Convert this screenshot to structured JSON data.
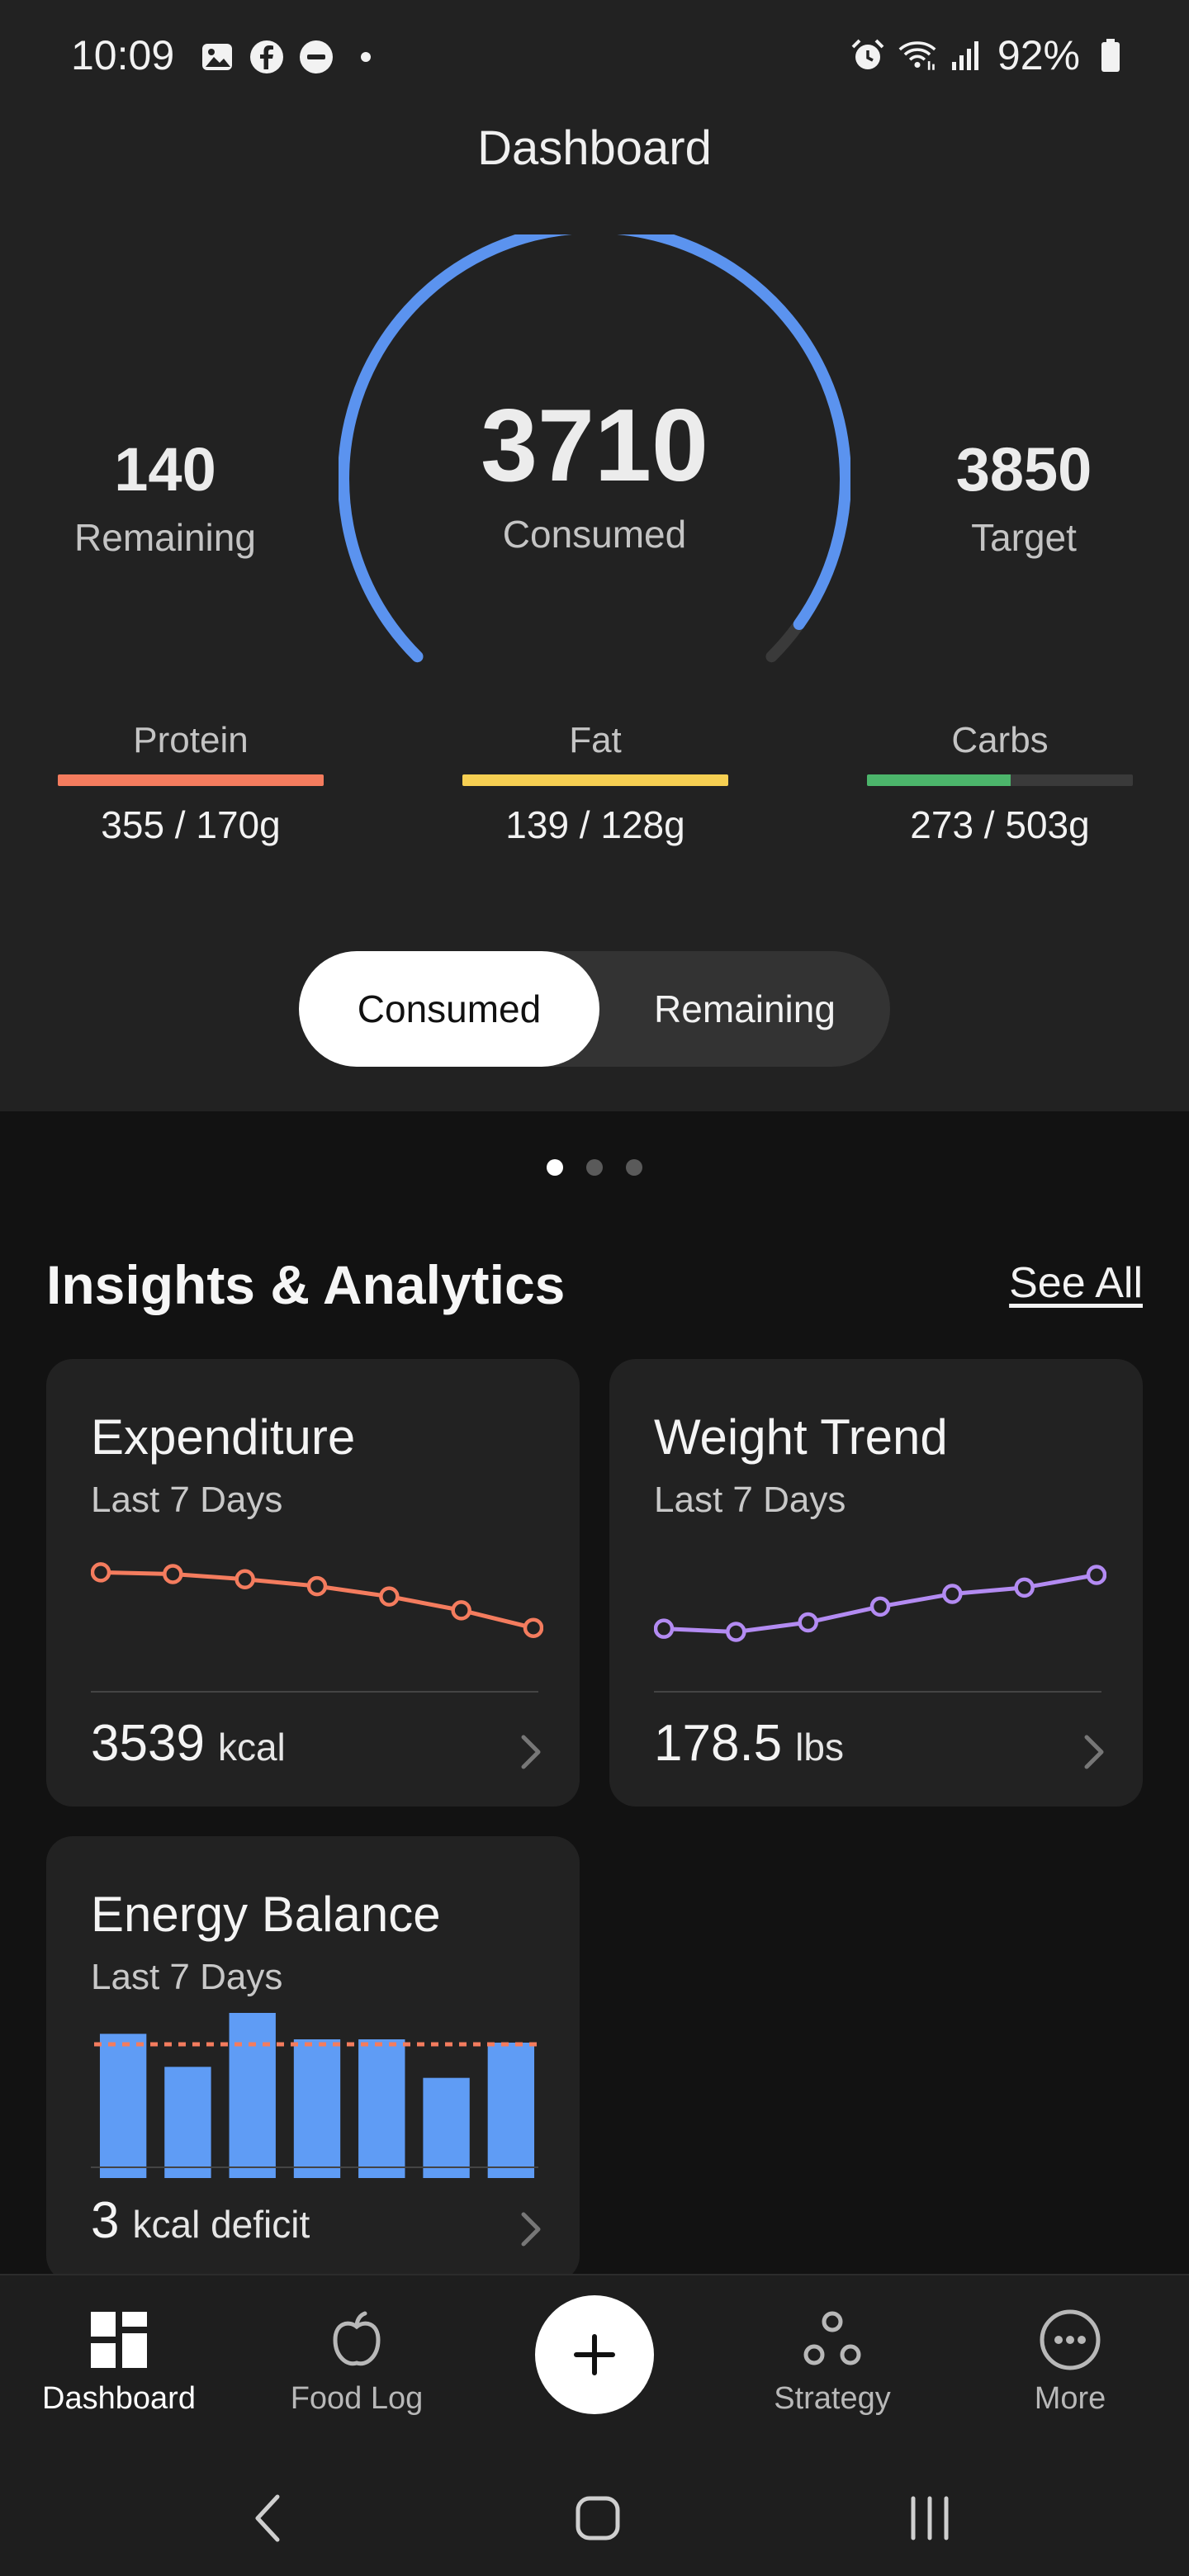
{
  "status_bar": {
    "time": "10:09",
    "battery": "92%",
    "icons": [
      "gallery-icon",
      "facebook-icon",
      "do-not-disturb-icon",
      "dot-icon",
      "alarm-icon",
      "wifi-icon",
      "signal-icon",
      "battery-icon"
    ]
  },
  "header": {
    "title": "Dashboard"
  },
  "summary": {
    "remaining_value": "140",
    "remaining_label": "Remaining",
    "consumed_value": "3710",
    "consumed_label": "Consumed",
    "target_value": "3850",
    "target_label": "Target",
    "gauge_progress": 0.964,
    "gauge_color": "#5b93ef"
  },
  "macros": [
    {
      "label": "Protein",
      "value": "355 / 170g",
      "progress": 1.0,
      "color": "#f47c5e"
    },
    {
      "label": "Fat",
      "value": "139 / 128g",
      "progress": 1.0,
      "color": "#f6cf52"
    },
    {
      "label": "Carbs",
      "value": "273 / 503g",
      "progress": 0.54,
      "color": "#4cb56b"
    }
  ],
  "toggle": {
    "consumed": "Consumed",
    "remaining": "Remaining",
    "selected": "Consumed"
  },
  "pager": {
    "count": 3,
    "active": 0
  },
  "insights": {
    "title": "Insights & Analytics",
    "see_all": "See All",
    "expenditure": {
      "title": "Expenditure",
      "subtitle": "Last 7 Days",
      "value": "3539",
      "unit": "kcal",
      "color": "#f47c5e"
    },
    "weight": {
      "title": "Weight Trend",
      "subtitle": "Last 7 Days",
      "value": "178.5",
      "unit": "lbs",
      "color": "#b38bf2"
    },
    "energy": {
      "title": "Energy Balance",
      "subtitle": "Last 7 Days",
      "value": "3",
      "unit": "kcal deficit",
      "bar_color": "#5f9cf5",
      "line_color": "#f47c5e"
    }
  },
  "chart_data": [
    {
      "type": "line",
      "title": "Expenditure",
      "x": [
        1,
        2,
        3,
        4,
        5,
        6,
        7
      ],
      "series": [
        {
          "values": [
            3700,
            3695,
            3680,
            3660,
            3630,
            3590,
            3539
          ]
        }
      ],
      "ylim": [
        3500,
        3720
      ]
    },
    {
      "type": "line",
      "title": "Weight Trend",
      "x": [
        1,
        2,
        3,
        4,
        5,
        6,
        7
      ],
      "series": [
        {
          "values": [
            176.8,
            176.7,
            177.0,
            177.5,
            177.9,
            178.1,
            178.5
          ]
        }
      ],
      "ylim": [
        176.4,
        178.8
      ]
    },
    {
      "type": "bar",
      "title": "Energy Balance",
      "categories": [
        "1",
        "2",
        "3",
        "4",
        "5",
        "6",
        "7"
      ],
      "values": [
        3900,
        3600,
        4100,
        3850,
        3850,
        3500,
        3820
      ],
      "target": 3850,
      "ylim": [
        0,
        4200
      ]
    }
  ],
  "bottom_nav": {
    "items": [
      {
        "label": "Dashboard",
        "icon": "dashboard-icon",
        "active": true
      },
      {
        "label": "Food Log",
        "icon": "apple-icon",
        "active": false
      },
      {
        "label": "Strategy",
        "icon": "strategy-icon",
        "active": false
      },
      {
        "label": "More",
        "icon": "more-icon",
        "active": false
      }
    ],
    "add_icon": "plus-icon"
  },
  "system_nav": [
    "back-icon",
    "home-icon",
    "recents-icon"
  ]
}
